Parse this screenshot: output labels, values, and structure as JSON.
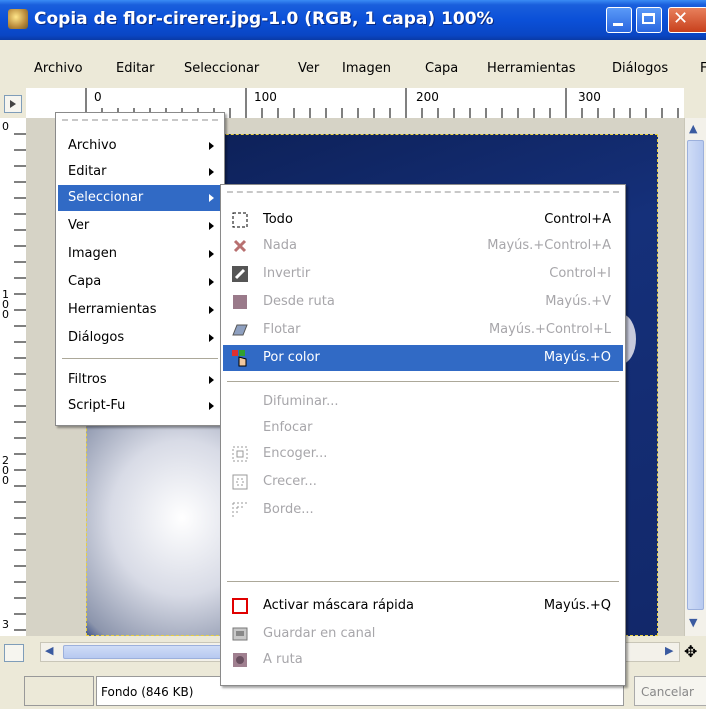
{
  "window": {
    "title": "Copia de flor-cirerer.jpg-1.0 (RGB, 1 capa) 100%"
  },
  "menubar": {
    "items": [
      "Archivo",
      "Editar",
      "Seleccionar",
      "Ver",
      "Imagen",
      "Capa",
      "Herramientas",
      "Diálogos",
      "F"
    ]
  },
  "rulers": {
    "h_labels": [
      "0",
      "100",
      "200",
      "300"
    ],
    "v_labels": [
      "0",
      "1\n0\n0",
      "2\n0\n0",
      "3"
    ]
  },
  "context_menu": {
    "items": [
      {
        "label": "Archivo"
      },
      {
        "label": "Editar"
      },
      {
        "label": "Seleccionar"
      },
      {
        "label": "Ver"
      },
      {
        "label": "Imagen"
      },
      {
        "label": "Capa"
      },
      {
        "label": "Herramientas"
      },
      {
        "label": "Diálogos"
      },
      {
        "label": "Filtros"
      },
      {
        "label": "Script-Fu"
      }
    ]
  },
  "submenu": {
    "items": [
      {
        "label": "Todo",
        "shortcut": "Control+A",
        "icon": "select-all-icon"
      },
      {
        "label": "Nada",
        "shortcut": "Mayús.+Control+A",
        "icon": "select-none-icon"
      },
      {
        "label": "Invertir",
        "shortcut": "Control+I",
        "icon": "invert-icon"
      },
      {
        "label": "Desde ruta",
        "shortcut": "Mayús.+V",
        "icon": "from-path-icon"
      },
      {
        "label": "Flotar",
        "shortcut": "Mayús.+Control+L",
        "icon": "float-icon"
      },
      {
        "label": "Por color",
        "shortcut": "Mayús.+O",
        "icon": "by-color-icon"
      },
      {
        "label": "Difuminar...",
        "shortcut": "",
        "icon": ""
      },
      {
        "label": "Enfocar",
        "shortcut": "",
        "icon": ""
      },
      {
        "label": "Encoger...",
        "shortcut": "",
        "icon": "shrink-icon"
      },
      {
        "label": "Crecer...",
        "shortcut": "",
        "icon": "grow-icon"
      },
      {
        "label": "Borde...",
        "shortcut": "",
        "icon": "border-icon"
      },
      {
        "label": "Activar máscara rápida",
        "shortcut": "Mayús.+Q",
        "icon": "quick-mask-icon"
      },
      {
        "label": "Guardar en canal",
        "shortcut": "",
        "icon": "save-channel-icon"
      },
      {
        "label": "A ruta",
        "shortcut": "",
        "icon": "to-path-icon"
      }
    ]
  },
  "statusbar": {
    "layer_info": "Fondo (846 KB)",
    "cancel_label": "Cancelar"
  },
  "colors": {
    "selection_highlight": "#316ac5",
    "title_blue": "#0b50d8",
    "disabled_text": "#a7a6aa"
  }
}
